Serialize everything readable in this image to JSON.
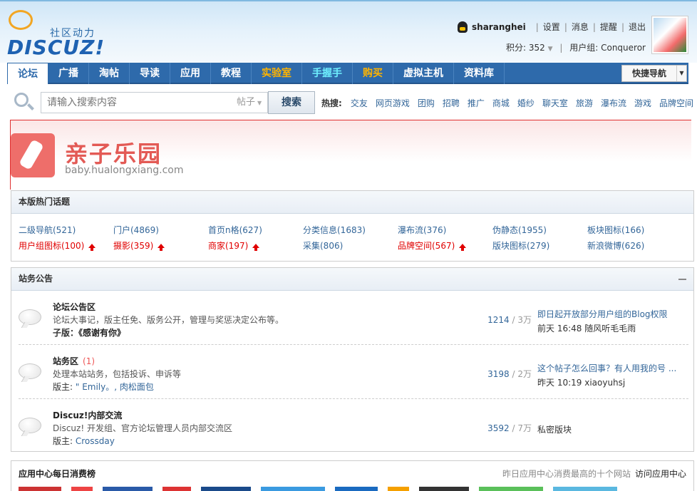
{
  "header": {
    "logo_slogan": "社区动力",
    "logo_text": "DISCUZ!",
    "user": {
      "username": "sharanghei",
      "links": [
        "设置",
        "消息",
        "提醒",
        "退出"
      ],
      "points_label": "积分: 352",
      "group_label": "用户组: Conqueror"
    }
  },
  "nav": {
    "items": [
      {
        "label": "论坛",
        "style": "active"
      },
      {
        "label": "广播",
        "style": "normal"
      },
      {
        "label": "淘帖",
        "style": "normal"
      },
      {
        "label": "导读",
        "style": "normal"
      },
      {
        "label": "应用",
        "style": "normal"
      },
      {
        "label": "教程",
        "style": "normal"
      },
      {
        "label": "实验室",
        "style": "orange"
      },
      {
        "label": "手握手",
        "style": "cyan"
      },
      {
        "label": "购买",
        "style": "orange"
      },
      {
        "label": "虚拟主机",
        "style": "normal"
      },
      {
        "label": "资料库",
        "style": "normal"
      }
    ],
    "quicknav_label": "快捷导航"
  },
  "search": {
    "placeholder": "请输入搜索内容",
    "type_value": "帖子",
    "button_label": "搜索",
    "hot_label": "热搜:",
    "hot_words": [
      "交友",
      "网页游戏",
      "团购",
      "招聘",
      "推广",
      "商城",
      "婚纱",
      "聊天室",
      "旅游",
      "瀑布流",
      "游戏",
      "品牌空间"
    ]
  },
  "banner": {
    "title": "亲子乐园",
    "url": "baby.hualongxiang.com"
  },
  "hot_topics": {
    "title": "本版热门话题",
    "rows": [
      [
        {
          "text": "二级导航(521)",
          "hot": false
        },
        {
          "text": "门户(4869)",
          "hot": false
        },
        {
          "text": "首页n格(627)",
          "hot": false
        },
        {
          "text": "分类信息(1683)",
          "hot": false
        },
        {
          "text": "瀑布流(376)",
          "hot": false
        },
        {
          "text": "伪静态(1955)",
          "hot": false
        },
        {
          "text": "板块图标(166)",
          "hot": false
        }
      ],
      [
        {
          "text": "用户组图标(100)",
          "hot": true
        },
        {
          "text": "摄影(359)",
          "hot": true
        },
        {
          "text": "商家(197)",
          "hot": true
        },
        {
          "text": "采集(806)",
          "hot": false
        },
        {
          "text": "品牌空间(567)",
          "hot": true
        },
        {
          "text": "版块图标(279)",
          "hot": false
        },
        {
          "text": "新浪微博(626)",
          "hot": false
        }
      ]
    ]
  },
  "announcements": {
    "title": "站务公告",
    "forums": [
      {
        "name": "论坛公告区",
        "today": "",
        "desc": "论坛大事记，版主任免、版务公开，管理与奖惩决定公布等。",
        "mod_label": "子版：",
        "mods": "《感谢有你》",
        "threads": "1214",
        "posts": "3万",
        "last_title": "即日起开放部分用户组的Blog权限",
        "last_meta": "前天 16:48 随风听毛毛雨"
      },
      {
        "name": "站务区",
        "today": "(1)",
        "desc": "处理本站站务，包括投诉、申诉等",
        "mod_label": "版主: ",
        "mods": "\" Emily。, 肉松面包",
        "threads": "3198",
        "posts": "2万",
        "last_title": "这个帖子怎么回事？有人用我的号 ...",
        "last_meta": "昨天 10:19 xiaoyuhsj"
      },
      {
        "name": "Discuz!内部交流",
        "today": "",
        "desc": "Discuz! 开发组、官方论坛管理人员内部交流区",
        "mod_label": "版主: ",
        "mods": "Crossday",
        "threads": "3592",
        "posts": "7万",
        "last_title": "",
        "last_meta": "私密版块"
      }
    ]
  },
  "app_center": {
    "title": "应用中心每日消费榜",
    "note": "昨日应用中心消费最高的十个网站",
    "link": "访问应用中心"
  },
  "colors": {
    "nav_bg": "#2e6aab",
    "link_blue": "#336699",
    "hot_red": "#e00000",
    "nav_orange": "#ffb400",
    "nav_cyan": "#6ff0ff"
  }
}
